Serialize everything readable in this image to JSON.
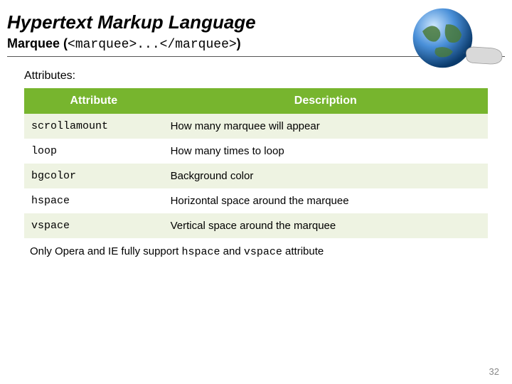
{
  "header": {
    "title": "Hypertext Markup Language",
    "subtitle_prefix": "Marquee (",
    "subtitle_code": "<marquee>...</marquee>",
    "subtitle_suffix": ")"
  },
  "content": {
    "attributes_label": "Attributes:",
    "table": {
      "head": {
        "attribute": "Attribute",
        "description": "Description"
      },
      "rows": [
        {
          "attr": "scrollamount",
          "desc": "How many marquee will appear"
        },
        {
          "attr": "loop",
          "desc": "How many times to loop"
        },
        {
          "attr": "bgcolor",
          "desc": "Background color"
        },
        {
          "attr": "hspace",
          "desc": "Horizontal space around the marquee"
        },
        {
          "attr": "vspace",
          "desc": "Vertical space around the marquee"
        }
      ]
    },
    "footnote": {
      "pre": "Only Opera and IE fully support ",
      "code1": "hspace",
      "mid": " and ",
      "code2": "vspace",
      "post": " attribute"
    }
  },
  "page_number": "32"
}
